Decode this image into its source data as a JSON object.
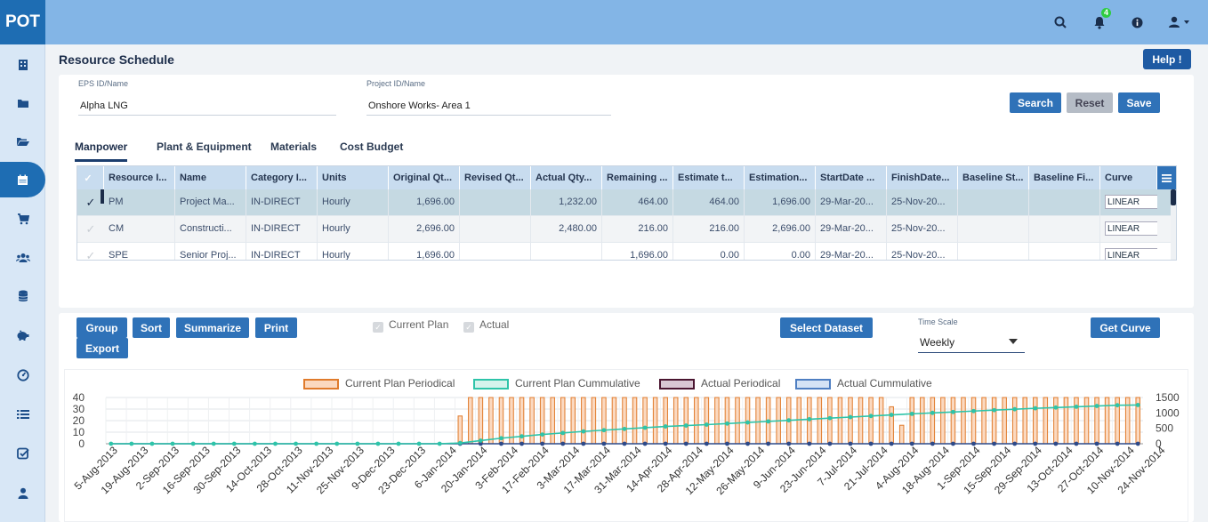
{
  "app": {
    "logo": "POT",
    "notification_count": "4"
  },
  "page": {
    "title": "Resource Schedule",
    "help_label": "Help !"
  },
  "filters": {
    "eps_label": "EPS ID/Name",
    "eps_value": "Alpha LNG",
    "project_label": "Project ID/Name",
    "project_value": "Onshore Works- Area 1",
    "search_label": "Search",
    "reset_label": "Reset",
    "save_label": "Save"
  },
  "tabs": [
    "Manpower",
    "Plant & Equipment",
    "Materials",
    "Cost Budget"
  ],
  "grid": {
    "columns": [
      "Resource I...",
      "Name",
      "Category I...",
      "Units",
      "Original Qt...",
      "Revised Qt...",
      "Actual Qty...",
      "Remaining ...",
      "Estimate t...",
      "Estimation...",
      "StartDate ...",
      "FinishDate...",
      "Baseline St...",
      "Baseline Fi...",
      "Curve"
    ],
    "rows": [
      [
        "PM",
        "Project Ma...",
        "IN-DIRECT",
        "Hourly",
        "1,696.00",
        "",
        "1,232.00",
        "464.00",
        "464.00",
        "1,696.00",
        "29-Mar-20...",
        "25-Nov-20...",
        "",
        "",
        "LINEAR"
      ],
      [
        "CM",
        "Constructi...",
        "IN-DIRECT",
        "Hourly",
        "2,696.00",
        "",
        "2,480.00",
        "216.00",
        "216.00",
        "2,696.00",
        "29-Mar-20...",
        "25-Nov-20...",
        "",
        "",
        "LINEAR"
      ],
      [
        "SPE",
        "Senior Proj...",
        "IN-DIRECT",
        "Hourly",
        "1,696.00",
        "",
        "",
        "1,696.00",
        "0.00",
        "0.00",
        "29-Mar-20...",
        "25-Nov-20...",
        "",
        "",
        "LINEAR"
      ]
    ]
  },
  "toolbar": {
    "group_label": "Group",
    "sort_label": "Sort",
    "summarize_label": "Summarize",
    "print_label": "Print",
    "export_label": "Export",
    "current_plan_label": "Current Plan",
    "actual_label": "Actual",
    "select_dataset_label": "Select Dataset",
    "timescale_label": "Time Scale",
    "timescale_value": "Weekly",
    "get_curve_label": "Get Curve"
  },
  "chart_data": {
    "type": "bar",
    "x_tick_labels": [
      "5-Aug-2013",
      "19-Aug-2013",
      "2-Sep-2013",
      "16-Sep-2013",
      "30-Sep-2013",
      "14-Oct-2013",
      "28-Oct-2013",
      "11-Nov-2013",
      "25-Nov-2013",
      "9-Dec-2013",
      "23-Dec-2013",
      "6-Jan-2014",
      "20-Jan-2014",
      "3-Feb-2014",
      "17-Feb-2014",
      "3-Mar-2014",
      "17-Mar-2014",
      "31-Mar-2014",
      "14-Apr-2014",
      "28-Apr-2014",
      "12-May-2014",
      "26-May-2014",
      "9-Jun-2014",
      "23-Jun-2014",
      "7-Jul-2014",
      "21-Jul-2014",
      "4-Aug-2014",
      "18-Aug-2014",
      "1-Sep-2014",
      "15-Sep-2014",
      "29-Sep-2014",
      "13-Oct-2014",
      "27-Oct-2014",
      "10-Nov-2014",
      "24-Nov-2014"
    ],
    "legend": [
      {
        "name": "Current Plan Periodical",
        "color": "#e07b2c",
        "fill": "#fbd9c0"
      },
      {
        "name": "Current Plan Cummulative",
        "color": "#2ec4a9",
        "fill": "#d5f3ec"
      },
      {
        "name": "Actual Periodical",
        "color": "#4a1530",
        "fill": "#d9c7d3"
      },
      {
        "name": "Actual Cummulative",
        "color": "#4f7fc2",
        "fill": "#d5e3f5"
      }
    ],
    "left_ticks": [
      "40",
      "30",
      "20",
      "10",
      "0"
    ],
    "right_ticks": [
      "1500",
      "1000",
      "500",
      "0"
    ],
    "left_ylim": [
      0,
      40
    ],
    "right_ylim": [
      0,
      1500
    ],
    "periodical_start_week": 34,
    "periodical_values": [
      24,
      40,
      40,
      40,
      40,
      40,
      40,
      40,
      40,
      40,
      40,
      40,
      40,
      40,
      40,
      40,
      40,
      40,
      40,
      40,
      40,
      40,
      40,
      40,
      40,
      40,
      40,
      40,
      40,
      40,
      40,
      40,
      40,
      40,
      40,
      40,
      40,
      40,
      40,
      40,
      40,
      40,
      32,
      16,
      40,
      40,
      40,
      40,
      40,
      40,
      40,
      40,
      40,
      40,
      40,
      40,
      40,
      40,
      40,
      40,
      40,
      40,
      40,
      40,
      40,
      40,
      40,
      40,
      40,
      40,
      40,
      40,
      40,
      40,
      40
    ],
    "periodical_note": "",
    "cumulative_points": [
      [
        0,
        0
      ],
      [
        33,
        0
      ],
      [
        34,
        24
      ],
      [
        38,
        180
      ],
      [
        42,
        300
      ],
      [
        46,
        400
      ],
      [
        50,
        480
      ],
      [
        54,
        560
      ],
      [
        58,
        620
      ],
      [
        62,
        690
      ],
      [
        66,
        760
      ],
      [
        70,
        830
      ],
      [
        74,
        900
      ],
      [
        78,
        970
      ],
      [
        82,
        1030
      ],
      [
        86,
        1090
      ],
      [
        90,
        1150
      ],
      [
        94,
        1200
      ],
      [
        98,
        1250
      ],
      [
        101,
        1260
      ]
    ]
  }
}
